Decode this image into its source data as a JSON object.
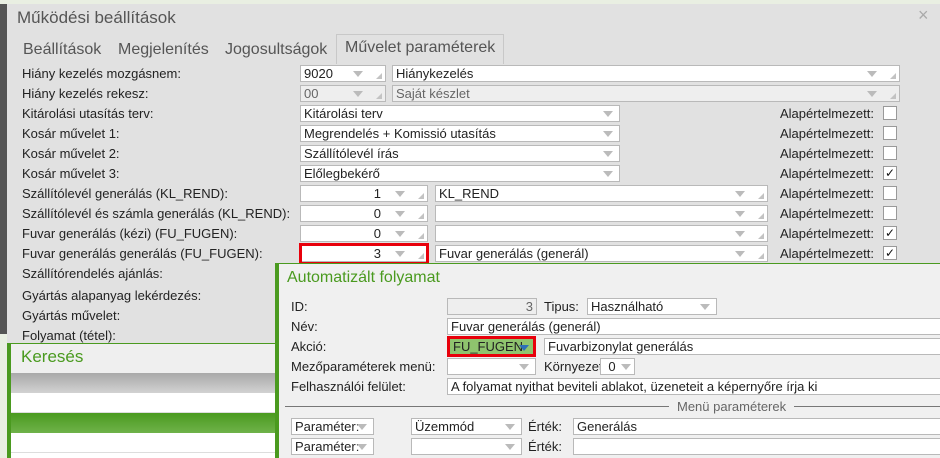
{
  "window": {
    "title": "Működési beállítások",
    "close": "×"
  },
  "tabs": [
    "Beállítások",
    "Megjelenítés",
    "Jogosultságok",
    "Művelet paraméterek"
  ],
  "rows": [
    {
      "label": "Hiány kezelés mozgásnem:",
      "code": "9020",
      "name": "Hiánykezelés"
    },
    {
      "label": "Hiány kezelés rekesz:",
      "code": "00",
      "name": "Saját készlet"
    },
    {
      "label": "Kitárolási utasítás terv:",
      "value": "Kitárolási terv",
      "default_label": "Alapértelmezett:",
      "checked": false
    },
    {
      "label": "Kosár művelet 1:",
      "value": "Megrendelés + Komissió utasítás",
      "default_label": "Alapértelmezett:",
      "checked": false
    },
    {
      "label": "Kosár művelet 2:",
      "value": "Szállítólevél írás",
      "default_label": "Alapértelmezett:",
      "checked": false
    },
    {
      "label": "Kosár művelet 3:",
      "value": "Előlegbekérő",
      "default_label": "Alapértelmezett:",
      "checked": true
    },
    {
      "label": "Szállítólevél generálás (KL_REND):",
      "num": "1",
      "name": "KL_REND",
      "default_label": "Alapértelmezett:",
      "checked": false
    },
    {
      "label": "Szállítólevél és számla generálás (KL_REND):",
      "num": "0",
      "name": "",
      "default_label": "Alapértelmezett:",
      "checked": false
    },
    {
      "label": "Fuvar generálás (kézi) (FU_FUGEN):",
      "num": "0",
      "name": "",
      "default_label": "Alapértelmezett:",
      "checked": true
    },
    {
      "label": "Fuvar generálás generálás (FU_FUGEN):",
      "num": "3",
      "name": "Fuvar generálás (generál)",
      "default_label": "Alapértelmezett:",
      "checked": true
    },
    {
      "label": "Szállítórendelés ajánlás:"
    },
    {
      "label": "Gyártás alapanyag lekérdezés:"
    },
    {
      "label": "Gyártás művelet:"
    },
    {
      "label": "Folyamat (tétel):"
    }
  ],
  "check_mark": "✓",
  "search": {
    "title": "Keresés"
  },
  "auto": {
    "title": "Automatizált folyamat",
    "id_label": "ID:",
    "id": "3",
    "type_label": "Tipus:",
    "type": "Használható",
    "name_label": "Név:",
    "name": "Fuvar generálás (generál)",
    "action_label": "Akció:",
    "action_code": "FU_FUGEN",
    "action_name": "Fuvarbizonylat generálás",
    "menu_label": "Mezőparaméterek menü:",
    "menu": "",
    "env_label": "Környezet:",
    "env": "0",
    "ui_label": "Felhasználói felület:",
    "ui": "A folyamat nyithat beviteli ablakot, üzeneteit a képernyőre írja ki",
    "section": "Menü paraméterek",
    "params": [
      {
        "param": "Paraméter:",
        "mode": "Üzemmód",
        "value_label": "Érték:",
        "value": "Generálás"
      },
      {
        "param": "Paraméter:",
        "mode": "",
        "value_label": "Érték:",
        "value": ""
      }
    ]
  }
}
